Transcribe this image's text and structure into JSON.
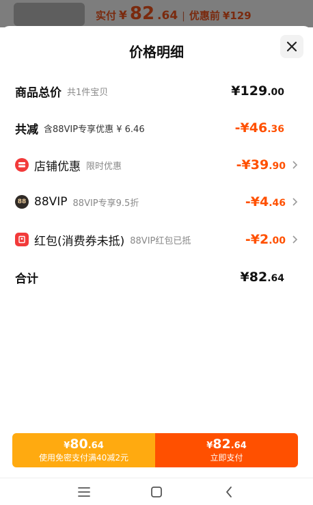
{
  "underlay": {
    "paid_label": "实付",
    "currency": "¥",
    "paid_int": "82",
    "paid_dec": ".64",
    "separator": "|",
    "orig_label": "优惠前",
    "orig_price": "¥129"
  },
  "sheet": {
    "title": "价格明细",
    "close_icon": "close-icon"
  },
  "rows": [
    {
      "name": "商品总价",
      "sub": "共1件宝贝",
      "amount_main": "¥129",
      "amount_dec": ".00",
      "color": "#111111"
    },
    {
      "name": "共减",
      "sub": "含88VIP专享优惠 ¥ 6.46",
      "amount_main": "-¥46",
      "amount_dec": ".36",
      "color": "#ff5000"
    },
    {
      "name": "店铺优惠",
      "sub": "限时优惠",
      "amount_main": "-¥39",
      "amount_dec": ".90",
      "color": "#ff5000",
      "icon": "shop-coupon-icon"
    },
    {
      "name": "88VIP",
      "sub": "88VIP专享9.5折",
      "amount_main": "-¥4",
      "amount_dec": ".46",
      "color": "#ff5000",
      "icon": "vip88-icon",
      "icon_text": "88"
    },
    {
      "name": "红包(消费券未抵)",
      "sub": "88VIP红包已抵",
      "amount_main": "-¥2",
      "amount_dec": ".00",
      "color": "#ff5000",
      "icon": "red-packet-icon"
    },
    {
      "name": "合计",
      "amount_main": "¥82",
      "amount_dec": ".64",
      "color": "#111111"
    }
  ],
  "buttons": {
    "left": {
      "currency": "¥",
      "int": "80",
      "dec": ".64",
      "sub": "使用免密支付满40减2元",
      "color": "#ffaa10"
    },
    "right": {
      "currency": "¥",
      "int": "82",
      "dec": ".64",
      "sub": "立即支付",
      "color": "#ff5000"
    }
  },
  "navbar": {
    "items": [
      "menu-icon",
      "home-icon",
      "back-icon"
    ]
  }
}
